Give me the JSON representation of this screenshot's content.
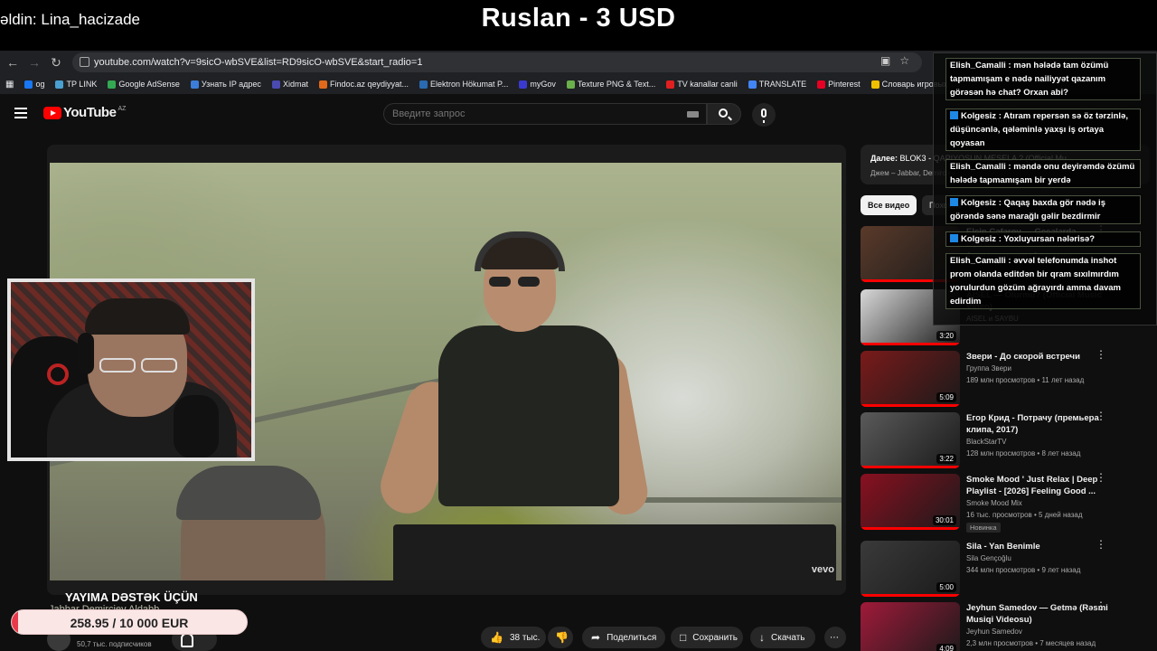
{
  "stream": {
    "follower_alert": "əldin: Lina_hacizade",
    "donation_alert": "Ruslan - 3 USD",
    "support_title": "YAYIMA DƏSTƏK ÜÇÜN",
    "support_sub": "Jabbar Demirciev Aldabb",
    "goal_text": "258.95 / 10 000 EUR",
    "goal_progress": 0.026
  },
  "browser": {
    "url": "youtube.com/watch?v=9sicO-wbSVE&list=RD9sicO-wbSVE&start_radio=1",
    "bookmarks": [
      {
        "label": "og",
        "color": "#1877f2"
      },
      {
        "label": "TP LINK",
        "color": "#4aa0d0"
      },
      {
        "label": "Google AdSense",
        "color": "#34a853"
      },
      {
        "label": "Узнать IP адрес",
        "color": "#3c7dd9"
      },
      {
        "label": "Xidmat",
        "color": "#4a4ab0"
      },
      {
        "label": "Findoc.az qeydiyyat...",
        "color": "#e06a1a"
      },
      {
        "label": "Elektron Hökumat P...",
        "color": "#2a6ab0"
      },
      {
        "label": "myGov",
        "color": "#3a3ad0"
      },
      {
        "label": "Texture PNG & Text...",
        "color": "#6ab04c"
      },
      {
        "label": "TV kanallar canli",
        "color": "#e02020"
      },
      {
        "label": "TRANSLATE",
        "color": "#4285f4"
      },
      {
        "label": "Pinterest",
        "color": "#e60023"
      },
      {
        "label": "Словарь игровых т...",
        "color": "#f0c000"
      }
    ]
  },
  "youtube": {
    "logo_text": "YouTube",
    "region": "AZ",
    "search_placeholder": "Введите запрос",
    "vevo": "vevo"
  },
  "video": {
    "subscribers": "50,7 тыс. подписчиков",
    "likes": "38 тыс.",
    "share": "Поделиться",
    "save": "Сохранить",
    "download": "Скачать"
  },
  "sidebar": {
    "upnext_label": "Далее:",
    "upnext_title": "BLOK3 - QAPIYOSUN MESELA ? (Official Mu...",
    "upnext_sub": "Джем – Jabbar, Demirciev",
    "chip_all": "Все видео",
    "chip_other": "Похожие",
    "recs": [
      {
        "title": "Elçin Cəfərov — Gecələrdə",
        "channel": "Elçin Cəfərov",
        "meta": "4 млн просмотров • 1 год назад",
        "duration": "",
        "thumb_color": "#5a3a2a"
      },
      {
        "title": "AISEL — Olurmu? (Official Music Video)",
        "channel": "AISEL и SAYBU",
        "meta": "",
        "duration": "3:20",
        "thumb_color": "#d8d8d8"
      },
      {
        "title": "Звери - До скорой встречи",
        "channel": "Группа Звери",
        "meta": "189 млн просмотров • 11 лет назад",
        "duration": "5:09",
        "thumb_color": "#7a1a1a"
      },
      {
        "title": "Егор Крид - Потрачу (премьера клипа, 2017)",
        "channel": "BlackStarTV",
        "meta": "128 млн просмотров • 8 лет назад",
        "duration": "3:22",
        "thumb_color": "#5a5a5a"
      },
      {
        "title": "Smoke Mood ' Just Relax | Deep Playlist - [2026] Feeling Good ...",
        "channel": "Smoke Mood Mix",
        "meta": "16 тыс. просмотров • 5 дней назад",
        "duration": "30:01",
        "badge": "Новинка",
        "thumb_color": "#8a1020"
      },
      {
        "title": "Sila - Yan Benimle",
        "channel": "Sila Gençoğlu",
        "meta": "344 млн просмотров • 9 лет назад",
        "duration": "5:00",
        "thumb_color": "#3a3a3a"
      },
      {
        "title": "Jeyhun Samedov — Getmə (Rəsmi Musiqi Videosu)",
        "channel": "Jeyhun Samedov",
        "meta": "2,3 млн просмотров • 7 месяцев назад",
        "duration": "4:09",
        "thumb_color": "#a01a3a"
      }
    ]
  },
  "chat": [
    {
      "user": "Elish_Camalli",
      "text": "mən hələdə tam özümü tapmamışam e nədə nailiyyət qazanım görəsən hə chat? Orxan abi?",
      "badge": false
    },
    {
      "user": "Kolgesiz",
      "text": "Atıram repersən sə öz tərzinlə, düşüncənlə, qələminlə yaxşı iş ortaya qoyasan",
      "badge": true
    },
    {
      "user": "Elish_Camalli",
      "text": "məndə onu deyirəmdə özümü hələdə tapmamışam bir yerdə",
      "badge": false
    },
    {
      "user": "Kolgesiz",
      "text": "Qaqaş baxda gör nədə iş görəndə sənə marağlı gəlir bezdirmir",
      "badge": true
    },
    {
      "user": "Kolgesiz",
      "text": "Yoxluyursan nələrisə?",
      "badge": true
    },
    {
      "user": "Elish_Camalli",
      "text": "əvvəl telefonumda inshot prom olanda editdən bir qram sıxılmırdım yorulurdun gözüm ağrayırdı amma davam edirdim",
      "badge": false
    }
  ]
}
